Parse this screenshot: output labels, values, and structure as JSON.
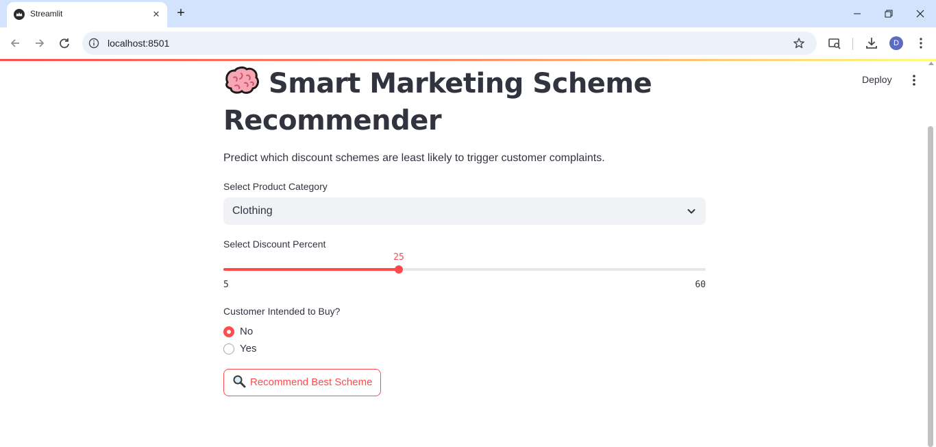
{
  "browser": {
    "tab_title": "Streamlit",
    "url": "localhost:8501",
    "profile_initial": "D"
  },
  "header": {
    "deploy_label": "Deploy"
  },
  "app": {
    "title": "Smart Marketing Scheme Recommender",
    "title_icon": "brain-emoji",
    "subtitle": "Predict which discount schemes are least likely to trigger customer complaints.",
    "category": {
      "label": "Select Product Category",
      "selected": "Clothing"
    },
    "discount": {
      "label": "Select Discount Percent",
      "value": "25",
      "min": "5",
      "max": "60"
    },
    "intent": {
      "label": "Customer Intended to Buy?",
      "options": [
        "No",
        "Yes"
      ],
      "selected": "No"
    },
    "button": {
      "label": "Recommend Best Scheme",
      "icon": "magnifier-emoji"
    }
  },
  "colors": {
    "primary": "#ff4b4b",
    "text": "#31333f",
    "input_bg": "#f0f2f6"
  }
}
